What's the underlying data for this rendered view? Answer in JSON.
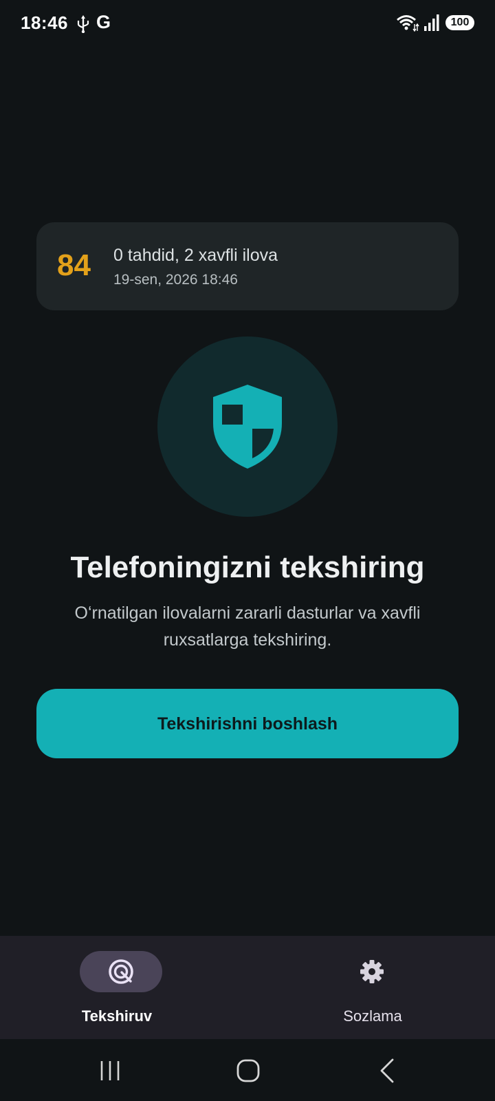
{
  "status_bar": {
    "time": "18:46",
    "g_label": "G",
    "battery": "100",
    "icons": [
      "usb-icon",
      "wifi-icon",
      "signal-icon"
    ]
  },
  "last_scan": {
    "score": "84",
    "summary": "0 tahdid, 2 xavfli ilova",
    "date": "19-sen, 2026 18:46"
  },
  "main": {
    "icon": "shield-icon",
    "title": "Telefoningizni tekshiring",
    "subtitle": "Oʻrnatilgan ilovalarni zararli dasturlar va xavfli ruxsatlarga tekshiring.",
    "start_button": "Tekshirishni boshlash"
  },
  "bottom_nav": {
    "items": [
      {
        "label": "Tekshiruv",
        "icon": "scan-icon",
        "active": true
      },
      {
        "label": "Sozlama",
        "icon": "gear-icon",
        "active": false
      }
    ]
  },
  "colors": {
    "background": "#101416",
    "card": "#1f2527",
    "accent": "#14b0b5",
    "score": "#e3a11a",
    "nav_background": "#201f27",
    "nav_pill": "#4a4458"
  }
}
